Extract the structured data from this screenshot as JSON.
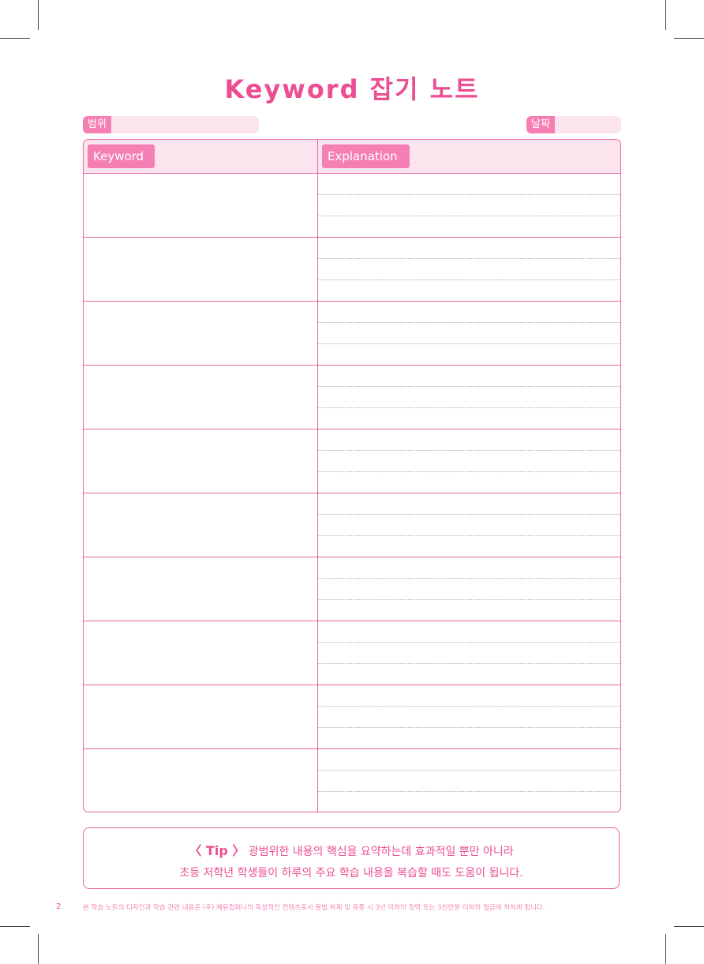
{
  "title": "Keyword 잡기 노트",
  "range_label": "범위",
  "date_label": "날짜",
  "table": {
    "keyword_header": "Keyword",
    "explanation_header": "Explanation"
  },
  "tip": {
    "label": "〈 Tip 〉",
    "line1": "광범위한 내용의 핵심을 요약하는데 효과적일 뿐만 아니라",
    "line2": "초등 저학년 학생들이 하루의 주요 학습 내용을 복습할 때도 도움이 됩니다."
  },
  "page_number": "2",
  "footer": "본 학습 노트의 디자인과 학습 관련 내용은 (주) 혜듀컴퍼니의 독창적인 컨텐츠로서 불법 복제 및 유통 시 3년 이하의 징역 또는 3천만원 이하의 벌금에 처하게 됩니다.",
  "colors": {
    "accent": "#ec4d93",
    "tag": "#f57fb2",
    "light": "#fce4ef"
  }
}
